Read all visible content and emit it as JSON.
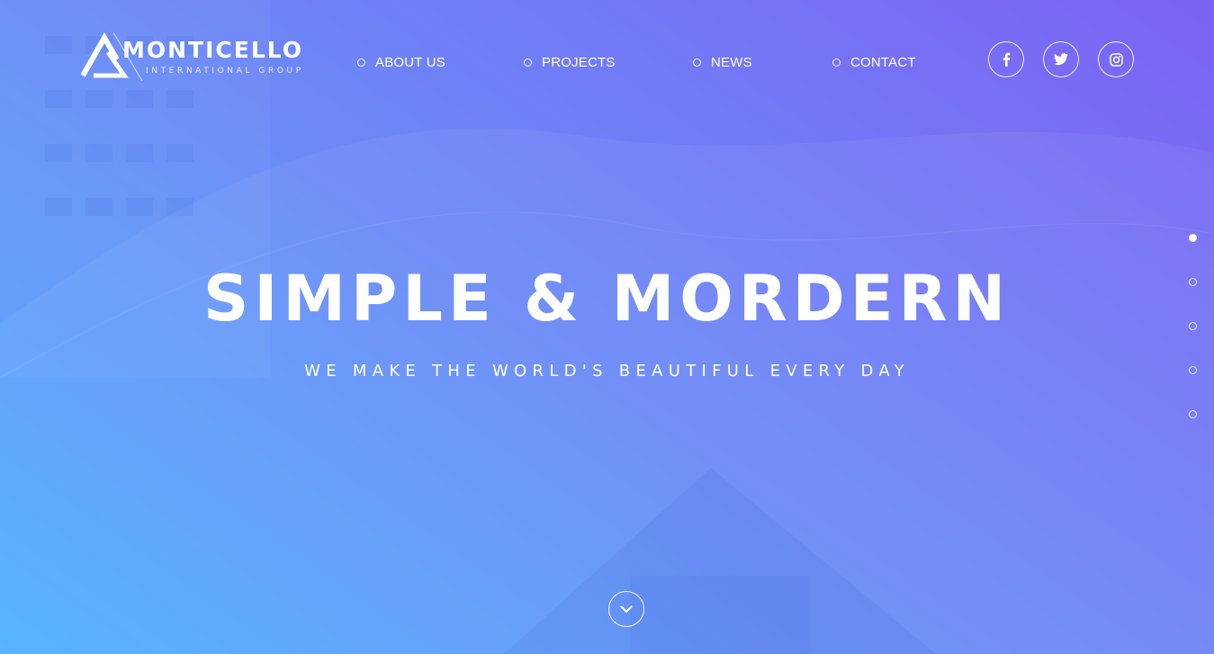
{
  "brand": {
    "name": "MONTICELLO",
    "tagline": "INTERNATIONAL GROUP"
  },
  "nav": {
    "items": [
      {
        "label": "ABOUT US"
      },
      {
        "label": "PROJECTS"
      },
      {
        "label": "NEWS"
      },
      {
        "label": "CONTACT"
      }
    ]
  },
  "social": {
    "items": [
      {
        "icon": "facebook-icon"
      },
      {
        "icon": "twitter-icon"
      },
      {
        "icon": "instagram-icon"
      }
    ]
  },
  "hero": {
    "headline": "SIMPLE & MORDERN",
    "subheadline": "WE MAKE THE WORLD'S BEAUTIFUL EVERY DAY"
  },
  "pagination": {
    "total": 5,
    "active_index": 0
  },
  "scroll_down": {
    "icon": "chevron-down-icon"
  },
  "colors": {
    "gradient_start": "#4fb0ff",
    "gradient_mid": "#6a8cf7",
    "gradient_end": "#7c63f3",
    "text": "#ffffff"
  }
}
